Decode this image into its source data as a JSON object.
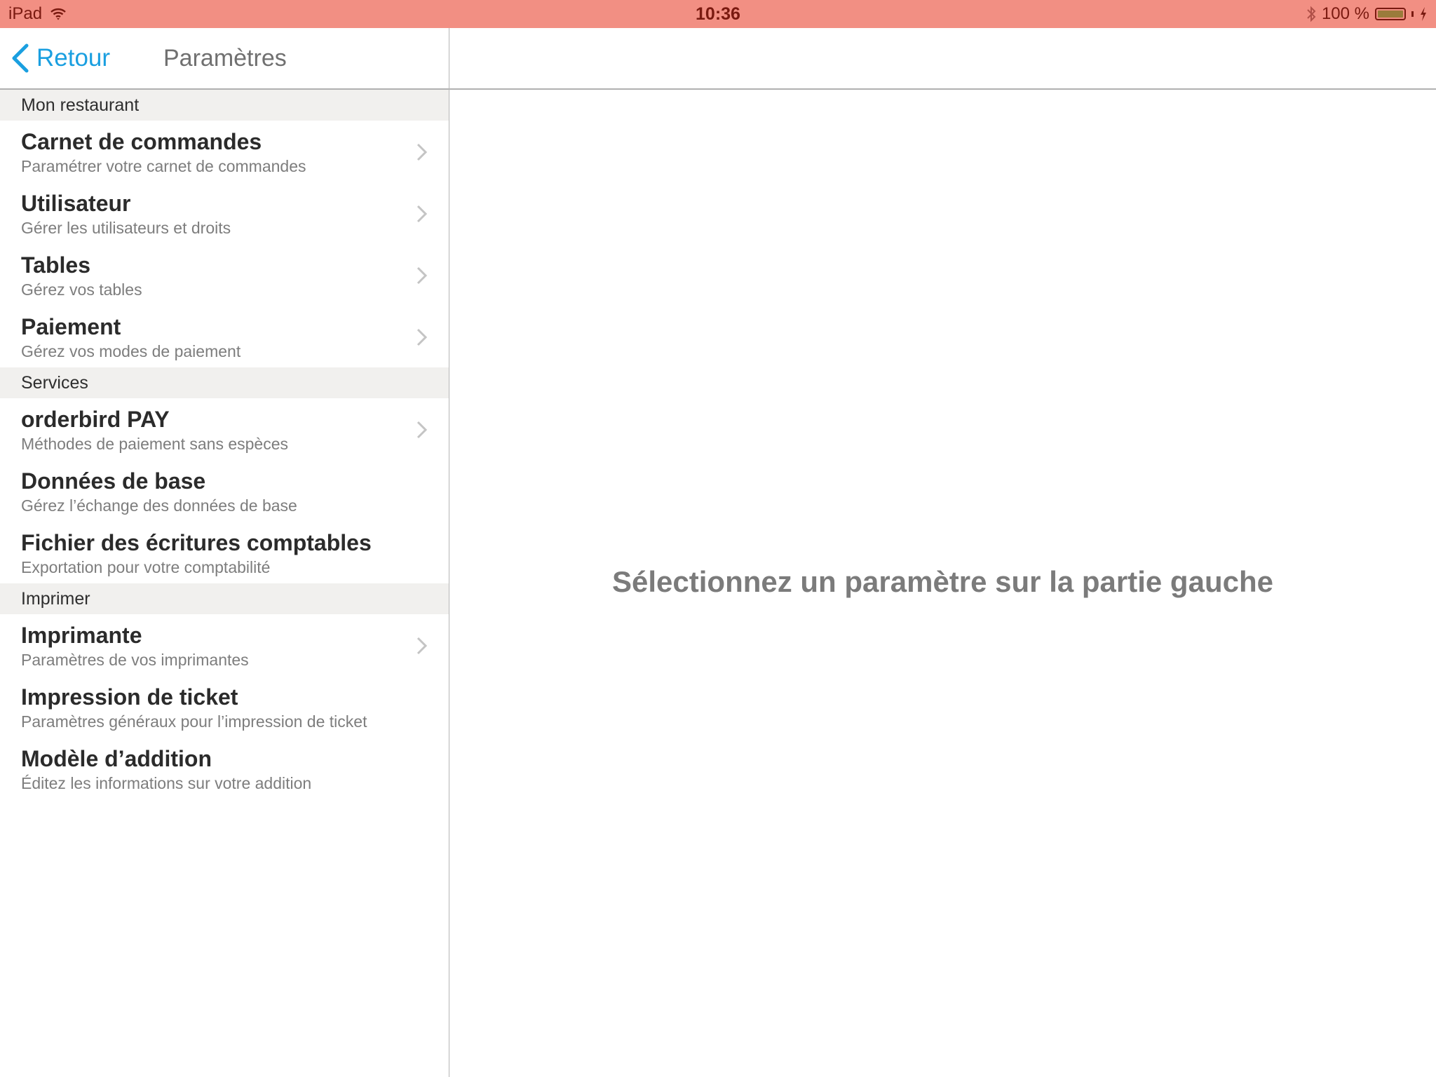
{
  "status_bar": {
    "device": "iPad",
    "wifi_icon": "wifi-icon",
    "time": "10:36",
    "bluetooth_icon": "bluetooth-icon",
    "battery_percent": "100 %",
    "battery_level": 1.0,
    "charging_icon": "charging-bolt-icon",
    "background_color": "#f28f83"
  },
  "nav": {
    "back_label": "Retour",
    "title": "Paramètres",
    "accent_color": "#1a9fe0"
  },
  "sections": [
    {
      "header": "Mon restaurant",
      "items": [
        {
          "title": "Carnet de commandes",
          "subtitle": "Paramétrer votre carnet de commandes",
          "has_chevron": true
        },
        {
          "title": "Utilisateur",
          "subtitle": "Gérer les utilisateurs et droits",
          "has_chevron": true
        },
        {
          "title": "Tables",
          "subtitle": "Gérez vos tables",
          "has_chevron": true
        },
        {
          "title": "Paiement",
          "subtitle": "Gérez vos modes de paiement",
          "has_chevron": true
        }
      ]
    },
    {
      "header": "Services",
      "items": [
        {
          "title": "orderbird PAY",
          "subtitle": "Méthodes de paiement sans espèces",
          "has_chevron": true
        },
        {
          "title": "Données de base",
          "subtitle": "Gérez l’échange des données de base",
          "has_chevron": false
        },
        {
          "title": "Fichier des écritures comptables",
          "subtitle": "Exportation pour votre comptabilité",
          "has_chevron": false
        }
      ]
    },
    {
      "header": "Imprimer",
      "items": [
        {
          "title": "Imprimante",
          "subtitle": "Paramètres de vos imprimantes",
          "has_chevron": true
        },
        {
          "title": "Impression de ticket",
          "subtitle": "Paramètres généraux pour l’impression de ticket",
          "has_chevron": false
        },
        {
          "title": "Modèle d’addition",
          "subtitle": "Éditez les informations sur votre addition",
          "has_chevron": false
        }
      ]
    }
  ],
  "detail": {
    "placeholder": "Sélectionnez un paramètre sur la partie gauche"
  }
}
